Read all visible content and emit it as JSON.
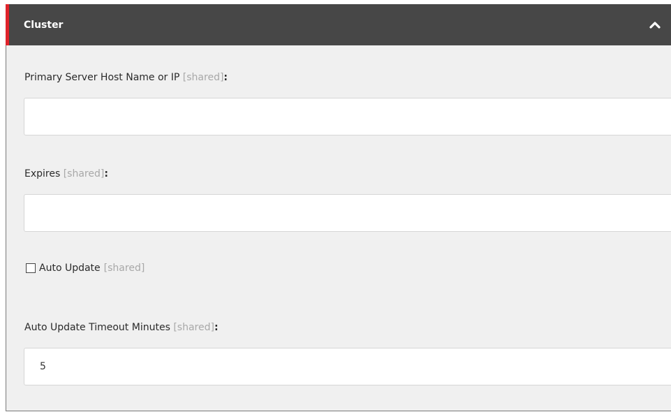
{
  "panel": {
    "title": "Cluster",
    "collapse_icon": "chevron-up-icon",
    "colors": {
      "header_bg": "#474747",
      "accent": "#e0232b",
      "panel_bg": "#f0f0f0"
    }
  },
  "fields": {
    "primary_server": {
      "label": "Primary Server Host Name or IP",
      "shared": "[shared]",
      "colon": ":",
      "value": ""
    },
    "expires": {
      "label": "Expires",
      "shared": "[shared]",
      "colon": ":",
      "value": ""
    },
    "auto_update": {
      "label": "Auto Update",
      "shared": "[shared]",
      "checked": false
    },
    "auto_update_timeout": {
      "label": "Auto Update Timeout Minutes",
      "shared": "[shared]",
      "colon": ":",
      "value": "5"
    }
  }
}
